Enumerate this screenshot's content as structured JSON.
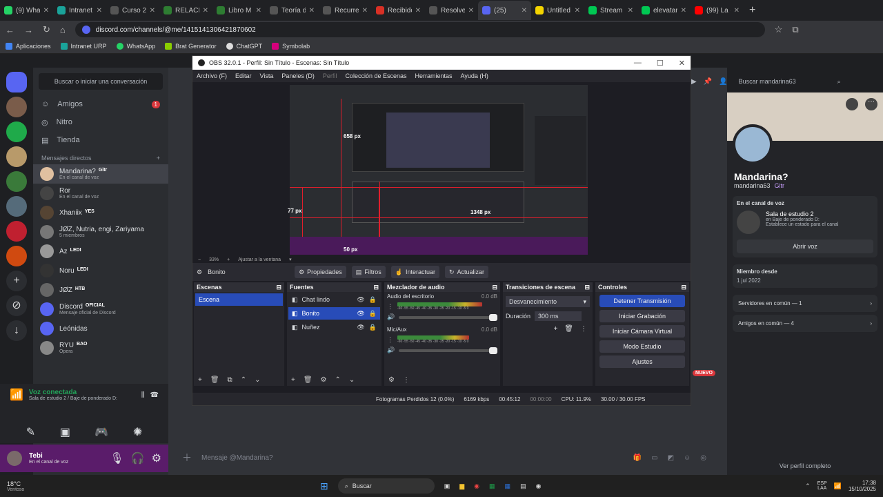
{
  "tabs": [
    {
      "label": "(9) What",
      "color": "#25d366"
    },
    {
      "label": "Intranet",
      "color": "#1aa39a"
    },
    {
      "label": "Curso 2:",
      "color": "#555"
    },
    {
      "label": "RELACIÓ",
      "color": "#2e7d32"
    },
    {
      "label": "Libro M",
      "color": "#2e7d32"
    },
    {
      "label": "Teoría de",
      "color": "#555"
    },
    {
      "label": "Recurrer",
      "color": "#555"
    },
    {
      "label": "Recibido",
      "color": "#d93025"
    },
    {
      "label": "Resolver",
      "color": "#555"
    },
    {
      "label": "(25)",
      "color": "#5865f2"
    },
    {
      "label": "Untitled",
      "color": "#f4d400"
    },
    {
      "label": "Stream",
      "color": "#00c853"
    },
    {
      "label": "elevatar",
      "color": "#00c853"
    },
    {
      "label": "(99) La c",
      "color": "#ff0000"
    }
  ],
  "url": "discord.com/channels/@me/1415141306421870602",
  "bookmarks": [
    "Aplicaciones",
    "Intranet URP",
    "WhatsApp",
    "Brat Generator",
    "ChatGPT",
    "Symbolab"
  ],
  "dm": {
    "search": "Buscar o iniciar una conversación",
    "nav": [
      {
        "label": "Amigos",
        "badge": "1"
      },
      {
        "label": "Nitro"
      },
      {
        "label": "Tienda"
      }
    ],
    "section": "Mensajes directos",
    "items": [
      {
        "name": "Mandarina?",
        "tag": "Gitr",
        "sub": "En el canal de voz",
        "color": "#e0c0a0"
      },
      {
        "name": "Ror",
        "tag": "",
        "sub": "En el canal de voz",
        "color": "#444"
      },
      {
        "name": "Xhaniix",
        "tag": "YES",
        "sub": "",
        "color": "#554433"
      },
      {
        "name": "JØZ, Nutria, engi, Zariyama",
        "tag": "",
        "sub": "5 miembros",
        "color": "#777"
      },
      {
        "name": "Az",
        "tag": "LEDI",
        "sub": "",
        "color": "#999"
      },
      {
        "name": "Noru",
        "tag": "LEDI",
        "sub": "",
        "color": "#333"
      },
      {
        "name": "JØZ",
        "tag": "HTB",
        "sub": "",
        "color": "#666"
      },
      {
        "name": "Discord",
        "tag": "OFICIAL",
        "sub": "Mensaje oficial de Discord",
        "color": "#5865f2"
      },
      {
        "name": "Leónidas",
        "tag": "",
        "sub": "",
        "color": "#5865f2"
      },
      {
        "name": "RYU",
        "tag": "BAO",
        "sub": "Opera",
        "color": "#888"
      }
    ]
  },
  "voice": {
    "status": "Voz conectada",
    "channel": "Sala de estudio 2 / Baje de ponderado D:"
  },
  "user": {
    "name": "Tebi",
    "sub": "En el canal de voz"
  },
  "obs": {
    "title": "OBS 32.0.1 - Perfil: Sin Título - Escenas: Sin Título",
    "menu": [
      "Archivo (F)",
      "Editar",
      "Vista",
      "Paneles (D)",
      "Perfil",
      "Colección de Escenas",
      "Herramientas",
      "Ayuda (H)"
    ],
    "zoom": "33%",
    "fit": "Ajustar a la ventana",
    "preview_labels": {
      "a": "658 px",
      "b": "1348 px",
      "c": "77 px",
      "d": "50 px"
    },
    "source_name": "Bonito",
    "toolbar": [
      "Propiedades",
      "Filtros",
      "Interactuar",
      "Actualizar"
    ],
    "scenes": {
      "title": "Escenas",
      "items": [
        "Escena"
      ]
    },
    "sources": {
      "title": "Fuentes",
      "items": [
        "Chat lindo",
        "Bonito",
        "Nuñez"
      ]
    },
    "mixer": {
      "title": "Mezclador de audio",
      "channels": [
        {
          "name": "Audio del escritorio",
          "db": "0.0 dB",
          "level": 0.85
        },
        {
          "name": "Mic/Aux",
          "db": "0.0 dB",
          "level": 0.72
        }
      ],
      "scale": "-60 -55 -50 -45 -40 -35 -30 -25 -20 -15 -10 -5 0"
    },
    "transitions": {
      "title": "Transiciones de escena",
      "type": "Desvanecimiento",
      "duration_label": "Duración",
      "duration": "300 ms"
    },
    "controls": {
      "title": "Controles",
      "buttons": [
        "Detener Transmisión",
        "Iniciar Grabación",
        "Iniciar Cámara Virtual",
        "Modo Estudio",
        "Ajustes"
      ]
    },
    "status": {
      "dropped": "Fotogramas Perdidos 12 (0.0%)",
      "kbps": "6169 kbps",
      "live": "00:45:12",
      "rec": "00:00:00",
      "cpu": "CPU: 11.9%",
      "fps": "30.00 / 30.00 FPS"
    },
    "nuevo": "NUEVO"
  },
  "chat": {
    "placeholder": "Mensaje @Mandarina?"
  },
  "profile": {
    "search": "Buscar mandarina63",
    "name": "Mandarina?",
    "handle": "mandarina63",
    "tag": "Gitr",
    "voice_title": "En el canal de voz",
    "voice_channel": "Sala de estudio 2",
    "voice_sub": "en Baje de ponderado D:",
    "voice_hint": "Establece un estado para el canal",
    "join": "Abrir voz",
    "member_label": "Miembro desde",
    "member_date": "1 jul 2022",
    "servers": "Servidores en común — 1",
    "friends": "Amigos en común — 4",
    "full": "Ver perfil completo"
  },
  "taskbar": {
    "weather": "18°C",
    "weather_sub": "Ventoso",
    "search": "Buscar",
    "lang": "ESP",
    "region": "LAA",
    "time": "17:38",
    "date": "15/10/2025"
  }
}
